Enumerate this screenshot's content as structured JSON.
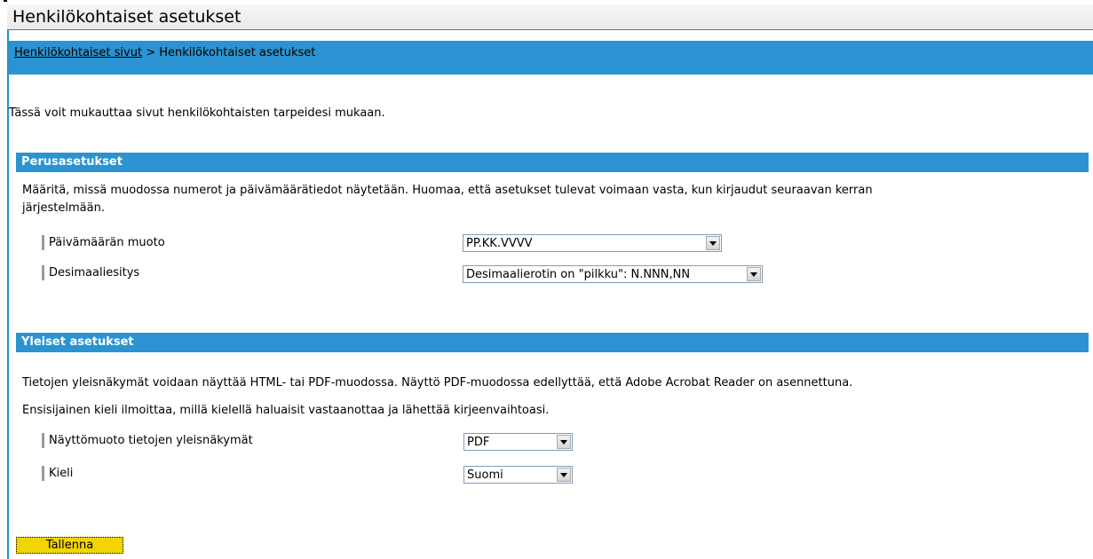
{
  "page": {
    "title": "Henkilökohtaiset asetukset",
    "intro": "Tässä voit mukauttaa sivut henkilökohtaisten tarpeidesi mukaan."
  },
  "breadcrumb": {
    "parent_link": "Henkilökohtaiset sivut",
    "separator": ">",
    "current": "Henkilökohtaiset asetukset"
  },
  "basic_settings": {
    "header": "Perusasetukset",
    "description_line1": "Määritä, missä muodossa numerot ja päivämäärätiedot näytetään. Huomaa, että asetukset tulevat voimaan vasta, kun kirjaudut seuraavan kerran",
    "description_line2": "järjestelmään.",
    "date_format": {
      "label": "Päivämäärän muoto",
      "value": "PP.KK.VVVV"
    },
    "decimal": {
      "label": "Desimaaliesitys",
      "value": "Desimaalierotin on \"pilkku\": N.NNN,NN"
    }
  },
  "general_settings": {
    "header": "Yleiset asetukset",
    "description1": "Tietojen yleisnäkymät voidaan näyttää HTML- tai PDF-muodossa. Näyttö PDF-muodossa edellyttää, että Adobe Acrobat Reader on asennettuna.",
    "description2": "Ensisijainen kieli ilmoittaa, millä kielellä haluaisit vastaanottaa ja lähettää kirjeenvaihtoasi.",
    "display_format": {
      "label": "Näyttömuoto tietojen yleisnäkymät",
      "value": "PDF"
    },
    "language": {
      "label": "Kieli",
      "value": "Suomi"
    }
  },
  "actions": {
    "save_label": "Tallenna"
  },
  "colors": {
    "accent_blue": "#2b93d1",
    "save_button": "#f2d400"
  }
}
